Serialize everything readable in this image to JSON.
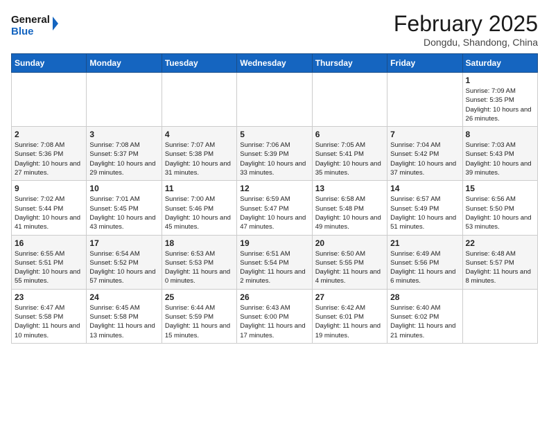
{
  "header": {
    "logo_line1": "General",
    "logo_line2": "Blue",
    "month_title": "February 2025",
    "location": "Dongdu, Shandong, China"
  },
  "weekdays": [
    "Sunday",
    "Monday",
    "Tuesday",
    "Wednesday",
    "Thursday",
    "Friday",
    "Saturday"
  ],
  "weeks": [
    [
      {
        "day": "",
        "info": ""
      },
      {
        "day": "",
        "info": ""
      },
      {
        "day": "",
        "info": ""
      },
      {
        "day": "",
        "info": ""
      },
      {
        "day": "",
        "info": ""
      },
      {
        "day": "",
        "info": ""
      },
      {
        "day": "1",
        "info": "Sunrise: 7:09 AM\nSunset: 5:35 PM\nDaylight: 10 hours and 26 minutes."
      }
    ],
    [
      {
        "day": "2",
        "info": "Sunrise: 7:08 AM\nSunset: 5:36 PM\nDaylight: 10 hours and 27 minutes."
      },
      {
        "day": "3",
        "info": "Sunrise: 7:08 AM\nSunset: 5:37 PM\nDaylight: 10 hours and 29 minutes."
      },
      {
        "day": "4",
        "info": "Sunrise: 7:07 AM\nSunset: 5:38 PM\nDaylight: 10 hours and 31 minutes."
      },
      {
        "day": "5",
        "info": "Sunrise: 7:06 AM\nSunset: 5:39 PM\nDaylight: 10 hours and 33 minutes."
      },
      {
        "day": "6",
        "info": "Sunrise: 7:05 AM\nSunset: 5:41 PM\nDaylight: 10 hours and 35 minutes."
      },
      {
        "day": "7",
        "info": "Sunrise: 7:04 AM\nSunset: 5:42 PM\nDaylight: 10 hours and 37 minutes."
      },
      {
        "day": "8",
        "info": "Sunrise: 7:03 AM\nSunset: 5:43 PM\nDaylight: 10 hours and 39 minutes."
      }
    ],
    [
      {
        "day": "9",
        "info": "Sunrise: 7:02 AM\nSunset: 5:44 PM\nDaylight: 10 hours and 41 minutes."
      },
      {
        "day": "10",
        "info": "Sunrise: 7:01 AM\nSunset: 5:45 PM\nDaylight: 10 hours and 43 minutes."
      },
      {
        "day": "11",
        "info": "Sunrise: 7:00 AM\nSunset: 5:46 PM\nDaylight: 10 hours and 45 minutes."
      },
      {
        "day": "12",
        "info": "Sunrise: 6:59 AM\nSunset: 5:47 PM\nDaylight: 10 hours and 47 minutes."
      },
      {
        "day": "13",
        "info": "Sunrise: 6:58 AM\nSunset: 5:48 PM\nDaylight: 10 hours and 49 minutes."
      },
      {
        "day": "14",
        "info": "Sunrise: 6:57 AM\nSunset: 5:49 PM\nDaylight: 10 hours and 51 minutes."
      },
      {
        "day": "15",
        "info": "Sunrise: 6:56 AM\nSunset: 5:50 PM\nDaylight: 10 hours and 53 minutes."
      }
    ],
    [
      {
        "day": "16",
        "info": "Sunrise: 6:55 AM\nSunset: 5:51 PM\nDaylight: 10 hours and 55 minutes."
      },
      {
        "day": "17",
        "info": "Sunrise: 6:54 AM\nSunset: 5:52 PM\nDaylight: 10 hours and 57 minutes."
      },
      {
        "day": "18",
        "info": "Sunrise: 6:53 AM\nSunset: 5:53 PM\nDaylight: 11 hours and 0 minutes."
      },
      {
        "day": "19",
        "info": "Sunrise: 6:51 AM\nSunset: 5:54 PM\nDaylight: 11 hours and 2 minutes."
      },
      {
        "day": "20",
        "info": "Sunrise: 6:50 AM\nSunset: 5:55 PM\nDaylight: 11 hours and 4 minutes."
      },
      {
        "day": "21",
        "info": "Sunrise: 6:49 AM\nSunset: 5:56 PM\nDaylight: 11 hours and 6 minutes."
      },
      {
        "day": "22",
        "info": "Sunrise: 6:48 AM\nSunset: 5:57 PM\nDaylight: 11 hours and 8 minutes."
      }
    ],
    [
      {
        "day": "23",
        "info": "Sunrise: 6:47 AM\nSunset: 5:58 PM\nDaylight: 11 hours and 10 minutes."
      },
      {
        "day": "24",
        "info": "Sunrise: 6:45 AM\nSunset: 5:58 PM\nDaylight: 11 hours and 13 minutes."
      },
      {
        "day": "25",
        "info": "Sunrise: 6:44 AM\nSunset: 5:59 PM\nDaylight: 11 hours and 15 minutes."
      },
      {
        "day": "26",
        "info": "Sunrise: 6:43 AM\nSunset: 6:00 PM\nDaylight: 11 hours and 17 minutes."
      },
      {
        "day": "27",
        "info": "Sunrise: 6:42 AM\nSunset: 6:01 PM\nDaylight: 11 hours and 19 minutes."
      },
      {
        "day": "28",
        "info": "Sunrise: 6:40 AM\nSunset: 6:02 PM\nDaylight: 11 hours and 21 minutes."
      },
      {
        "day": "",
        "info": ""
      }
    ]
  ]
}
